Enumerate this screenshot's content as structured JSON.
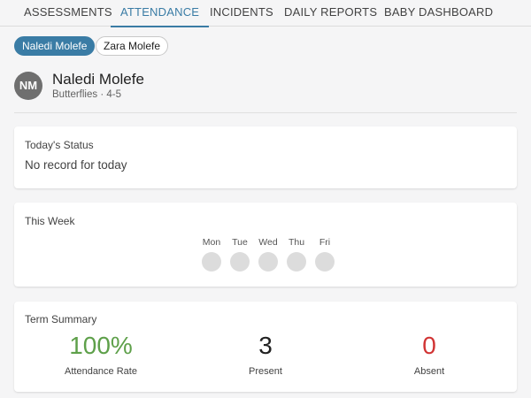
{
  "nav": {
    "tabs": [
      {
        "label": "ASSESSMENTS",
        "active": false
      },
      {
        "label": "ATTENDANCE",
        "active": true
      },
      {
        "label": "INCIDENTS",
        "active": false
      },
      {
        "label": "DAILY REPORTS",
        "active": false
      },
      {
        "label": "BABY DASHBOARD",
        "active": false
      }
    ]
  },
  "children": [
    {
      "name": "Naledi Molefe",
      "selected": true
    },
    {
      "name": "Zara Molefe",
      "selected": false
    }
  ],
  "profile": {
    "initials": "NM",
    "name": "Naledi Molefe",
    "group": "Butterflies · 4-5"
  },
  "today_status": {
    "title": "Today's Status",
    "text": "No record for today"
  },
  "this_week": {
    "title": "This Week",
    "days": [
      "Mon",
      "Tue",
      "Wed",
      "Thu",
      "Fri"
    ]
  },
  "term_summary": {
    "title": "Term Summary",
    "attendance_rate": {
      "value": "100%",
      "label": "Attendance Rate",
      "color": "#5ea04a"
    },
    "present": {
      "value": "3",
      "label": "Present",
      "color": "#212121"
    },
    "absent": {
      "value": "0",
      "label": "Absent",
      "color": "#d13434"
    }
  },
  "colors": {
    "accent": "#3a7ca5",
    "avatar": "#6f6f6f",
    "empty_day": "#dcdcdc"
  }
}
